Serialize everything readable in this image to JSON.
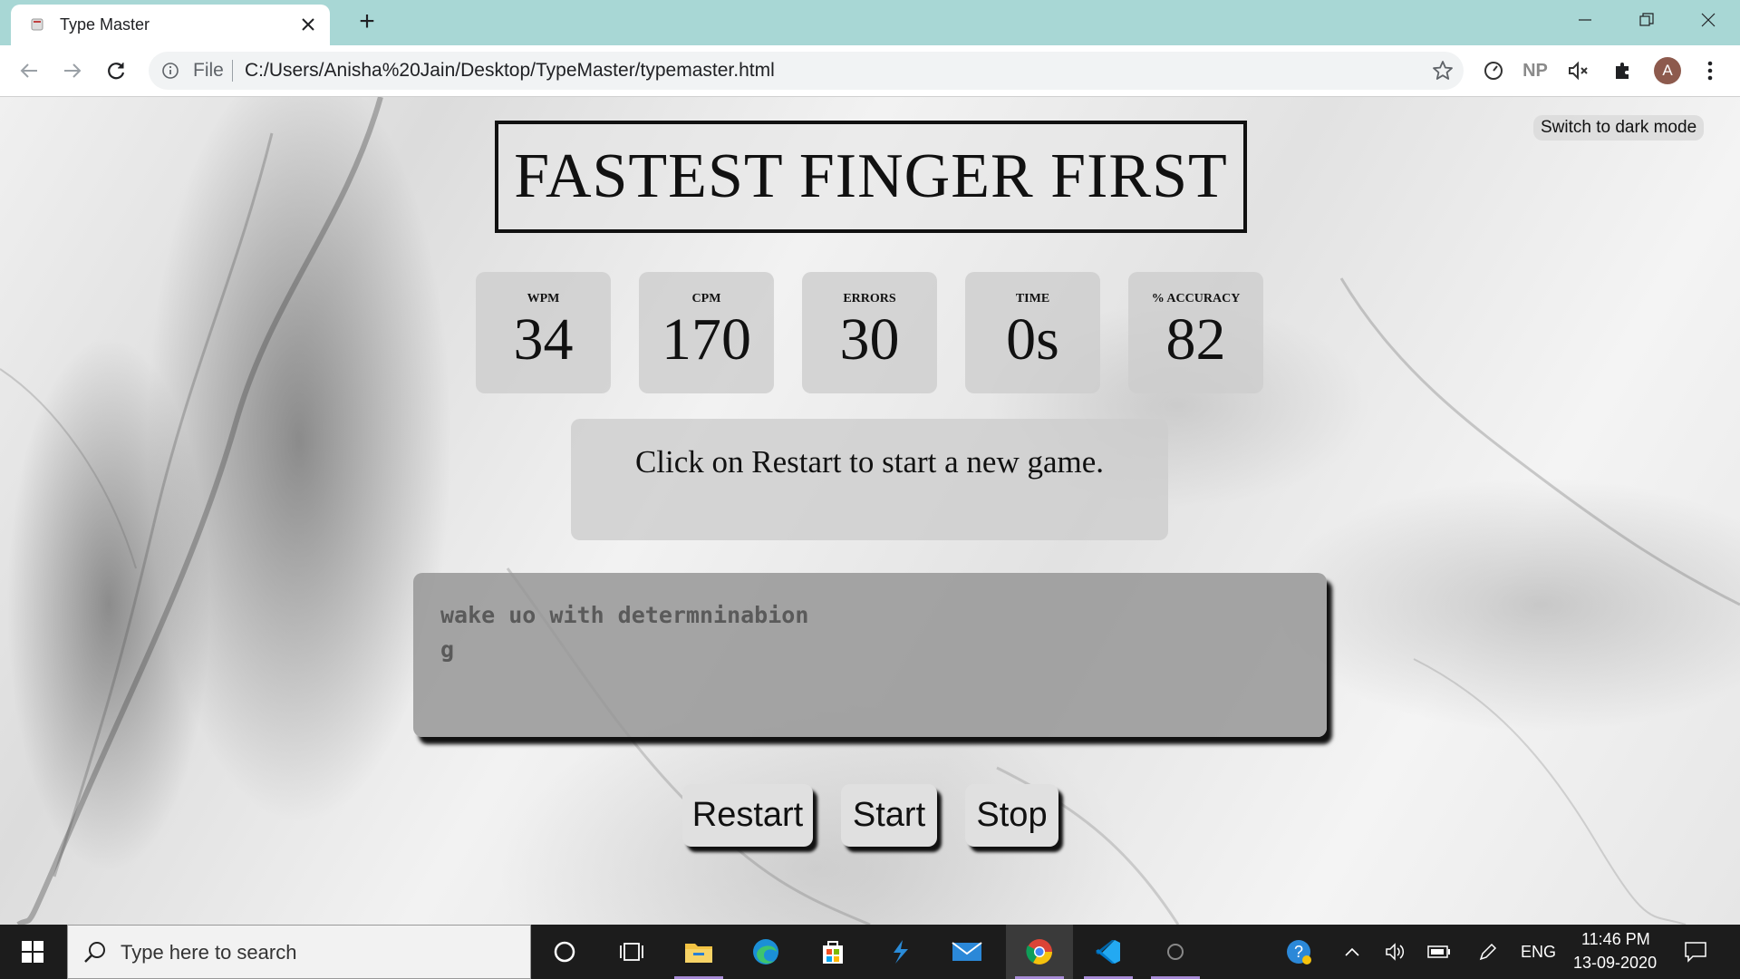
{
  "browser": {
    "tab_title": "Type Master",
    "new_tab_symbol": "+",
    "address_scheme": "File",
    "address_url": "C:/Users/Anisha%20Jain/Desktop/TypeMaster/typemaster.html",
    "extension_np": "NP",
    "avatar_letter": "A"
  },
  "page": {
    "dark_mode_toggle": "Switch to dark mode",
    "title": "FASTEST FINGER FIRST",
    "stats": [
      {
        "label": "WPM",
        "value": "34"
      },
      {
        "label": "CPM",
        "value": "170"
      },
      {
        "label": "ERRORS",
        "value": "30"
      },
      {
        "label": "TIME",
        "value": "0s"
      },
      {
        "label": "% ACCURACY",
        "value": "82"
      }
    ],
    "message": "Click on Restart to start a new game.",
    "typed_text": "wake uo with determninabion\ng",
    "buttons": {
      "restart": "Restart",
      "start": "Start",
      "stop": "Stop"
    }
  },
  "taskbar": {
    "search_placeholder": "Type here to search",
    "language": "ENG",
    "time": "11:46 PM",
    "date": "13-09-2020",
    "pinned_apps": [
      "cortana",
      "task-view",
      "file-explorer",
      "edge",
      "store",
      "vs-app",
      "mail",
      "chrome",
      "vscode",
      "obs"
    ]
  },
  "colors": {
    "tabbar_bg": "#a8d7d5",
    "taskbar_bg": "#1c1c1c",
    "accent_underline": "#a78bd6"
  }
}
